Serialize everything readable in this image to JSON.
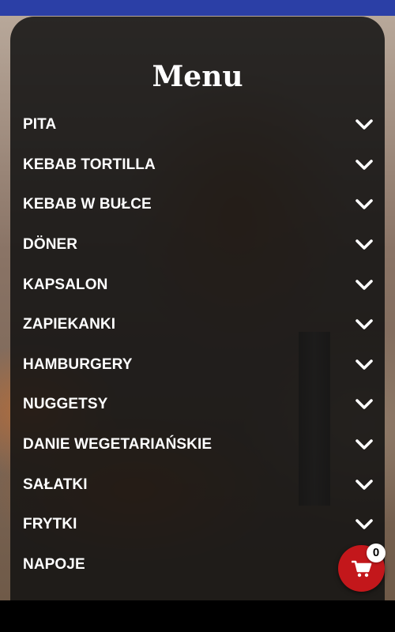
{
  "menu": {
    "title": "Menu",
    "items": [
      {
        "label": "PITA"
      },
      {
        "label": "KEBAB TORTILLA"
      },
      {
        "label": "KEBAB W BUŁCE"
      },
      {
        "label": "DÖNER"
      },
      {
        "label": "KAPSALON"
      },
      {
        "label": "ZAPIEKANKI"
      },
      {
        "label": "HAMBURGERY"
      },
      {
        "label": "NUGGETSY"
      },
      {
        "label": "DANIE WEGETARIAŃSKIE"
      },
      {
        "label": "SAŁATKI"
      },
      {
        "label": "FRYTKI"
      },
      {
        "label": "NAPOJE"
      }
    ]
  },
  "cart": {
    "count": "0",
    "icon": "cart-icon",
    "color": "#c3171b"
  },
  "colors": {
    "status_bar": "#2b3fa6",
    "panel": "#121212",
    "text": "#ffffff"
  }
}
